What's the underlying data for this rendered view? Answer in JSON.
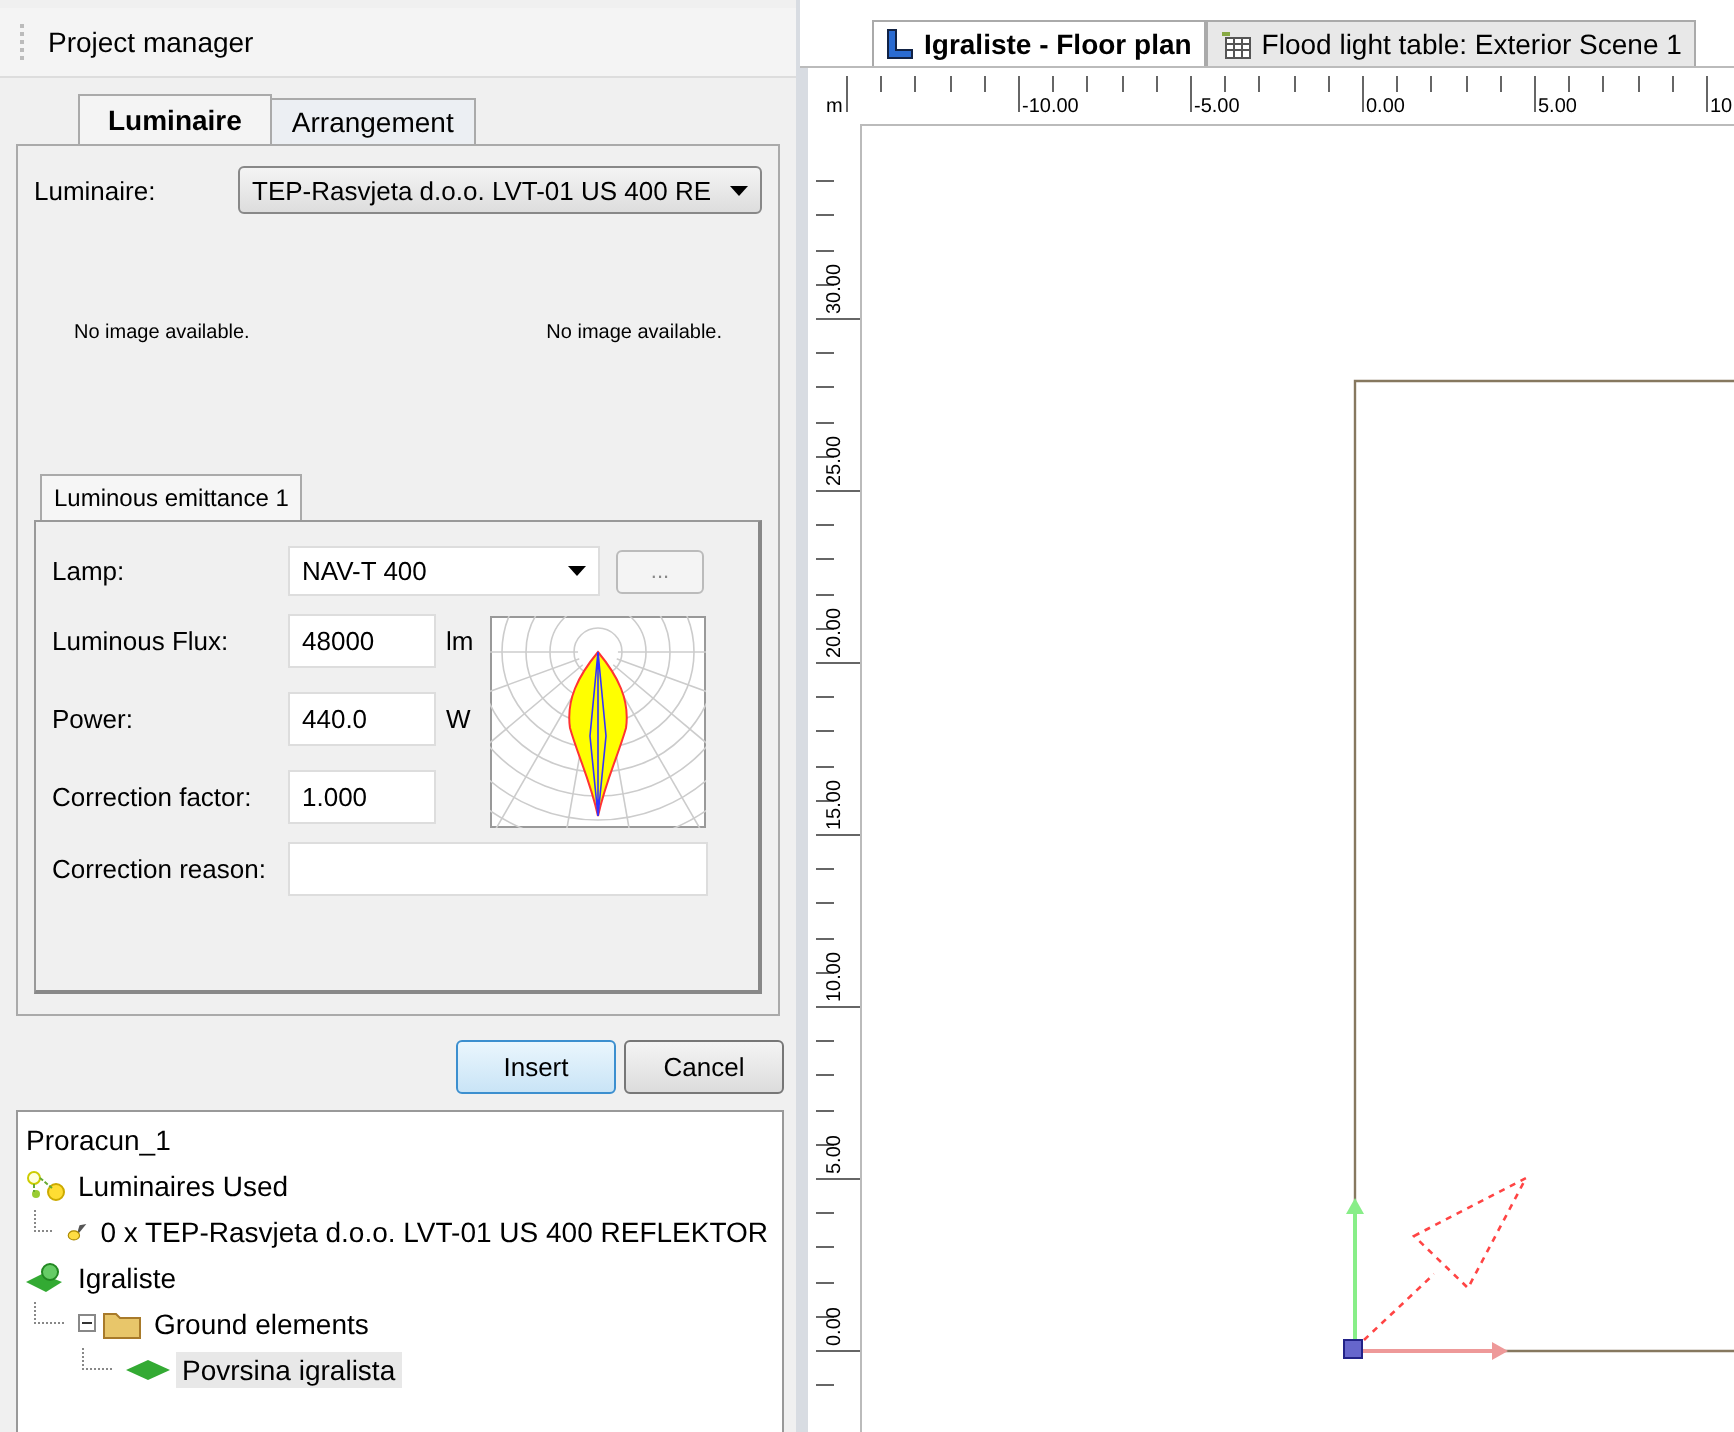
{
  "panel": {
    "title": "Project manager",
    "tabs": [
      {
        "label": "Luminaire",
        "selected": true
      },
      {
        "label": "Arrangement",
        "selected": false
      }
    ],
    "luminaire": {
      "label": "Luminaire:",
      "value": "TEP-Rasvjeta d.o.o. LVT-01 US 400 RE"
    },
    "image_notes": [
      "No image available.",
      "No image available."
    ],
    "sub_tabs": [
      {
        "label": "Luminous emittance 1",
        "selected": true
      }
    ],
    "lamp": {
      "label": "Lamp:",
      "value": "NAV-T 400",
      "more": "..."
    },
    "fields": [
      {
        "label": "Luminous Flux:",
        "value": "48000",
        "unit": "lm"
      },
      {
        "label": "Power:",
        "value": "440.0",
        "unit": "W"
      },
      {
        "label": "Correction factor:",
        "value": "1.000"
      }
    ],
    "reason": {
      "label": "Correction reason:"
    },
    "buttons": [
      {
        "label": "Insert",
        "default": true
      },
      {
        "label": "Cancel",
        "default": false
      }
    ]
  },
  "tree": {
    "label": "Proracun_1",
    "children": [
      {
        "label": "Luminaires Used",
        "kind": "luminaire-group",
        "selected": false,
        "children": [
          {
            "label": "0 x TEP-Rasvjeta d.o.o. LVT-01 US 400 REFLEKTOR",
            "kind": "luminaire",
            "selected": false
          }
        ]
      },
      {
        "label": "Igraliste",
        "kind": "site",
        "selected": false,
        "children": [
          {
            "label": "Ground elements",
            "kind": "folder",
            "selected": false,
            "expanded": true,
            "children": [
              {
                "label": "Povrsina igralista",
                "kind": "ground",
                "selected": true
              }
            ]
          }
        ]
      }
    ]
  },
  "view_tabs": [
    {
      "label": "Igraliste - Floor plan",
      "kind": "plan",
      "selected": true
    },
    {
      "label": "Flood light table: Exterior Scene 1",
      "kind": "table",
      "selected": false
    }
  ],
  "ruler": {
    "unit": "m",
    "x_labels": [
      "-10.00",
      "-5.00",
      "0.00",
      "5.00",
      "10."
    ],
    "y_labels": [
      "30.00",
      "25.00",
      "20.00",
      "15.00",
      "10.00",
      "5.00",
      "0.00"
    ]
  }
}
